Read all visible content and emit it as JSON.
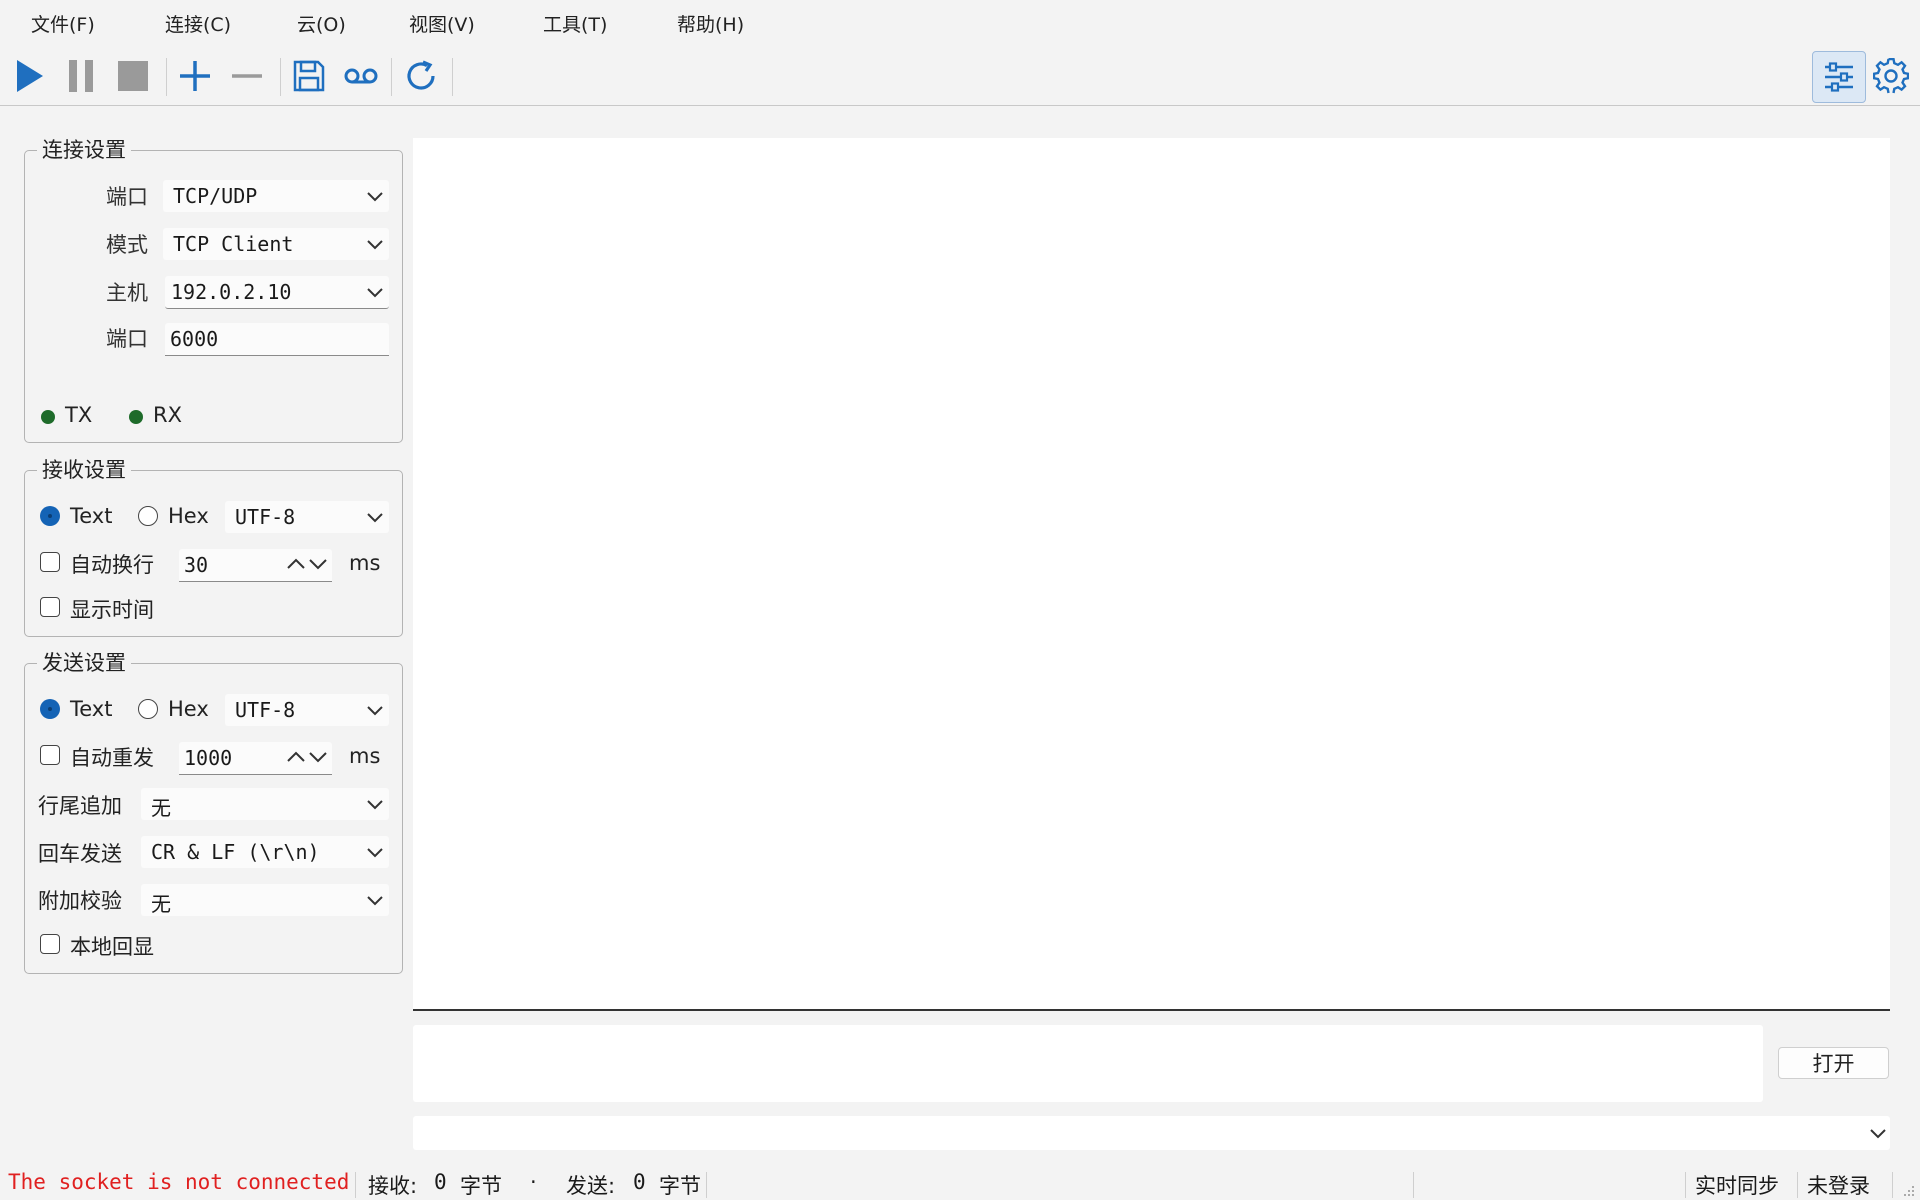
{
  "menu": [
    "文件(F)",
    "连接(C)",
    "云(O)",
    "视图(V)",
    "工具(T)",
    "帮助(H)"
  ],
  "toolbar": {
    "icons": [
      "play-icon",
      "pause-icon",
      "stop-icon",
      "plus-icon",
      "minus-icon",
      "save-icon",
      "record-icon",
      "refresh-icon",
      "settings-panel-icon",
      "gear-icon"
    ],
    "accent": "#1f6fbf"
  },
  "connection": {
    "title": "连接设置",
    "port_type_label": "端口",
    "port_type": "TCP/UDP",
    "mode_label": "模式",
    "mode": "TCP Client",
    "host_label": "主机",
    "host": "192.0.2.10",
    "port_label": "端口",
    "port": "6000",
    "tx": "TX",
    "rx": "RX"
  },
  "receive": {
    "title": "接收设置",
    "text": "Text",
    "hex": "Hex",
    "encoding": "UTF-8",
    "auto_wrap": "自动换行",
    "wrap_ms": "30",
    "ms": "ms",
    "show_time": "显示时间"
  },
  "send": {
    "title": "发送设置",
    "text": "Text",
    "hex": "Hex",
    "encoding": "UTF-8",
    "auto_resend": "自动重发",
    "resend_ms": "1000",
    "ms": "ms",
    "line_end_label": "行尾追加",
    "line_end": "无",
    "enter_label": "回车发送",
    "enter": "CR & LF (\\r\\n)",
    "checksum_label": "附加校验",
    "checksum": "无",
    "echo": "本地回显"
  },
  "open_button": "打开",
  "status": {
    "error": "The socket is not connected",
    "recv_label": "接收:",
    "recv_count": "0",
    "recv_unit": "字节",
    "dot": "·",
    "send_label": "发送:",
    "send_count": "0",
    "send_unit": "字节",
    "sync": "实时同步",
    "login": "未登录"
  },
  "colors": {
    "error": "#e02020",
    "led": "#1e6b2a",
    "radio": "#1463b5"
  }
}
